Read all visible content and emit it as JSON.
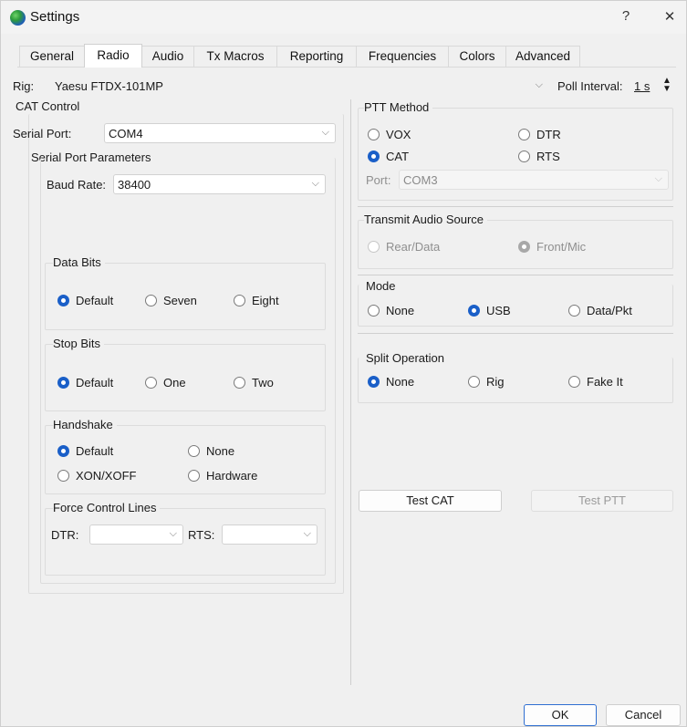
{
  "window": {
    "title": "Settings",
    "help": "?",
    "close": "✕"
  },
  "tabs": [
    "General",
    "Radio",
    "Audio",
    "Tx Macros",
    "Reporting",
    "Frequencies",
    "Colors",
    "Advanced"
  ],
  "active_tab": "Radio",
  "rig": {
    "label": "Rig:",
    "value": "Yaesu FTDX-101MP",
    "poll_label": "Poll Interval:",
    "poll_value": "1 s"
  },
  "cat_control": {
    "title": "CAT Control",
    "serial_port_label": "Serial Port:",
    "serial_port_value": "COM4",
    "spp": {
      "title": "Serial Port Parameters",
      "baud_label": "Baud Rate:",
      "baud_value": "38400",
      "data_bits": {
        "title": "Data Bits",
        "options": [
          "Default",
          "Seven",
          "Eight"
        ],
        "selected": "Default"
      },
      "stop_bits": {
        "title": "Stop Bits",
        "options": [
          "Default",
          "One",
          "Two"
        ],
        "selected": "Default"
      },
      "handshake": {
        "title": "Handshake",
        "options": [
          "Default",
          "None",
          "XON/XOFF",
          "Hardware"
        ],
        "selected": "Default"
      },
      "force_control": {
        "title": "Force Control Lines",
        "dtr_label": "DTR:",
        "dtr_value": "",
        "rts_label": "RTS:",
        "rts_value": ""
      }
    }
  },
  "ptt_method": {
    "title": "PTT Method",
    "options": [
      "VOX",
      "DTR",
      "CAT",
      "RTS"
    ],
    "selected": "CAT",
    "port_label": "Port:",
    "port_value": "COM3"
  },
  "transmit_audio_source": {
    "title": "Transmit Audio Source",
    "options": [
      "Rear/Data",
      "Front/Mic"
    ],
    "selected": "Front/Mic"
  },
  "mode": {
    "title": "Mode",
    "options": [
      "None",
      "USB",
      "Data/Pkt"
    ],
    "selected": "USB"
  },
  "split_operation": {
    "title": "Split Operation",
    "options": [
      "None",
      "Rig",
      "Fake It"
    ],
    "selected": "None"
  },
  "buttons": {
    "test_cat": "Test CAT",
    "test_ptt": "Test PTT",
    "ok": "OK",
    "cancel": "Cancel"
  },
  "colors": {
    "accent": "#1a5fc8",
    "window_bg": "#f0f0f0"
  }
}
